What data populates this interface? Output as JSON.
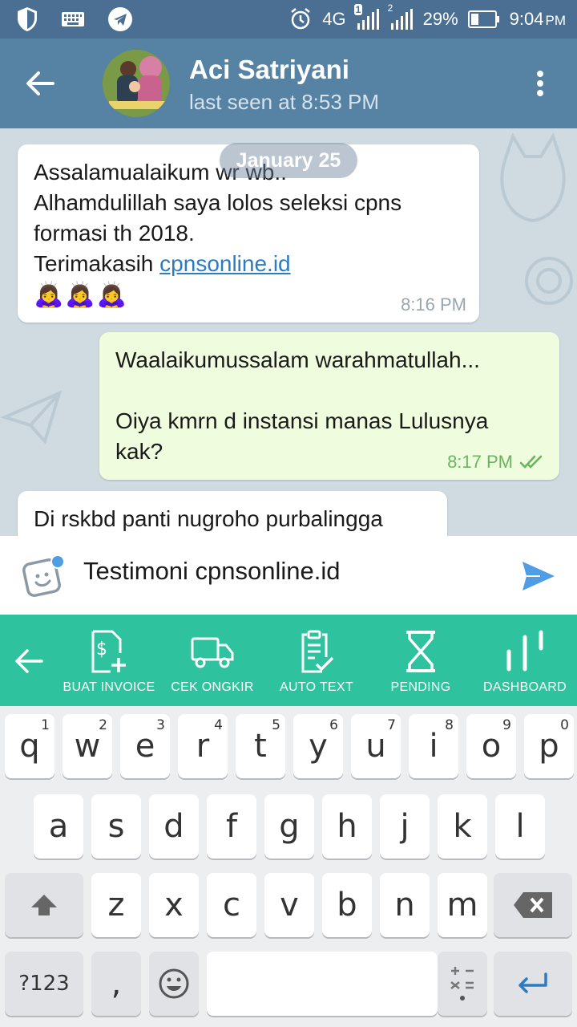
{
  "status_bar": {
    "network": "4G",
    "sim1_badge": "1",
    "sim2_badge": "2",
    "battery": "29%",
    "time": "9:04",
    "ampm": "PM"
  },
  "header": {
    "contact_name": "Aci Satriyani",
    "last_seen": "last seen at 8:53 PM"
  },
  "chat": {
    "date_label": "January 25",
    "messages": [
      {
        "line1": "Assalamualaikum wr wb..",
        "line2": "Alhamdulillah saya lolos seleksi cpns",
        "line3": "formasi th 2018.",
        "line4_prefix": "Terimakasih ",
        "link": "cpnsonline.id",
        "emojis": "🙇‍♀️🙇‍♀️🙇‍♀️",
        "time": "8:16 PM"
      },
      {
        "line1": "Waalaikumussalam warahmatullah...",
        "line2": "Oiya kmrn d instansi manas Lulusnya",
        "line3": "kak?",
        "time": "8:17 PM"
      },
      {
        "line1": "Di rskbd panti nugroho purbalingga"
      }
    ]
  },
  "input": {
    "text": "Testimoni cpnsonline.id"
  },
  "toolbar": {
    "items": [
      {
        "label": "BUAT INVOICE"
      },
      {
        "label": "CEK ONGKIR"
      },
      {
        "label": "AUTO TEXT"
      },
      {
        "label": "PENDING"
      },
      {
        "label": "DASHBOARD"
      }
    ]
  },
  "keyboard": {
    "row1": [
      "q",
      "w",
      "e",
      "r",
      "t",
      "y",
      "u",
      "i",
      "o",
      "p"
    ],
    "row1_nums": [
      "1",
      "2",
      "3",
      "4",
      "5",
      "6",
      "7",
      "8",
      "9",
      "0"
    ],
    "row2": [
      "a",
      "s",
      "d",
      "f",
      "g",
      "h",
      "j",
      "k",
      "l"
    ],
    "row3": [
      "z",
      "x",
      "c",
      "v",
      "b",
      "n",
      "m"
    ],
    "symbols_label": "?123",
    "comma": ","
  },
  "colors": {
    "header": "#5682a3",
    "status_bar": "#4a6f93",
    "toolbar": "#2ec29e",
    "outgoing_bubble": "#effdde",
    "link": "#2d7bc1",
    "send": "#4f9ee5"
  }
}
